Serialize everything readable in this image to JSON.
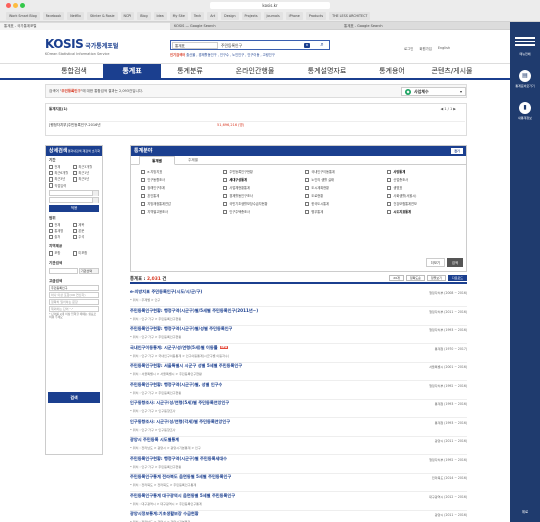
{
  "browser": {
    "url": "kosis.kr",
    "bookmarks": [
      "Work Smart Blog",
      "Facebook",
      "Netflix",
      "Stinter & Rosie",
      "NCPI",
      "Blog",
      "Idea",
      "My Site",
      "Tech",
      "Art",
      "Design",
      "Projects",
      "Journals",
      "iPhone",
      "Products",
      "THE LESS ARCHITECT"
    ],
    "tabs": [
      "통계표 - 국가통계포털",
      "KOSIS — Google Search",
      "통계표 - Google Search"
    ]
  },
  "header": {
    "logo_main": "KOSIS",
    "logo_kr": "국가통계포털",
    "logo_en": "KOrean Statistical Information Service",
    "search_select": "통계표",
    "search_query": "주민등록인구",
    "search_clear": "×",
    "search_button": "⌕",
    "keywords_label": "인기검색어",
    "keywords": "출산율 , 경제활동인구 , 인구수 , 노인인구 , 인구이동 , 고령인구",
    "util_links": [
      "로그인",
      "회원가입",
      "English"
    ]
  },
  "gnb": {
    "items": [
      "통합검색",
      "통계표",
      "통계분류",
      "온라인간행물",
      "통계설명자료",
      "통계용어",
      "콘텐츠/게시물"
    ],
    "active_index": 1
  },
  "result_bar": {
    "text_prefix": "검색어 \"",
    "keyword": "주민등록인구",
    "text_suffix": "\"에 대한 통합검색 결과는 2,093건입니다.",
    "button_label": "사업체수",
    "button_icon": "◆",
    "button_arrow": "▾"
  },
  "number_box": {
    "title": "통계지표(1)",
    "pager": "◀ 1 / 1 ▶",
    "row_label": "[행정자치부]주민등록인구-2016년",
    "row_value": "51,696,216 (명)"
  },
  "side": {
    "title": "상세검색",
    "reset": "결과내검색  재검색  초기화",
    "period_title": "기간",
    "period_options": [
      "전체",
      "최근3개월",
      "최근6개월",
      "최근1년",
      "최근3년",
      "최근5년",
      "직접입력"
    ],
    "from_placeholder": "",
    "to_placeholder": "",
    "apply": "적용",
    "scope_title": "범위",
    "scope_options": [
      "전체",
      "제목",
      "통계명",
      "본문",
      "출처",
      "주석"
    ],
    "sort_title": "지역제공",
    "sort_options": [
      "포함",
      "미포함"
    ],
    "org_title": "기관검색",
    "org_input": "",
    "org_button": "기관선택",
    "advanced_title": "고급검색",
    "adv1": "주민등록인구",
    "adv2": "하나 이상 포함(OR 연산자)",
    "adv3": "정확히 일치하는 문장",
    "adv4": "제외하는 단어 \"-\"",
    "note": "* 단어를 2개 이상 입력할 때에는 쉼표로 띄워 주세요",
    "search_button": "검색"
  },
  "classify": {
    "title": "통계분야",
    "toggle": "접기",
    "tabs": [
      "통계별",
      "주제별"
    ],
    "items": [
      {
        "label": "e-지방지표",
        "bold": false
      },
      {
        "label": "주민등록인구현황",
        "bold": false
      },
      {
        "label": "국내인구이동통계",
        "bold": false
      },
      {
        "label": "사망통계",
        "bold": true
      },
      {
        "label": "인구동향조사",
        "bold": false
      },
      {
        "label": "세대구성통계",
        "bold": true
      },
      {
        "label": "노인의 생활 실태",
        "bold": false
      },
      {
        "label": "산업총조사",
        "bold": false
      },
      {
        "label": "장래인구추계",
        "bold": false
      },
      {
        "label": "사업체현황통계",
        "bold": false
      },
      {
        "label": "도시계획현황",
        "bold": false
      },
      {
        "label": "생명표",
        "bold": false
      },
      {
        "label": "혼인통계",
        "bold": false
      },
      {
        "label": "경제활동인구조사",
        "bold": false
      },
      {
        "label": "도로현황",
        "bold": false
      },
      {
        "label": "사회생활(서울시)",
        "bold": false
      },
      {
        "label": "지방재정통계연감",
        "bold": false
      },
      {
        "label": "국민기초생활보장수급자현황",
        "bold": false
      },
      {
        "label": "한국도시통계",
        "bold": false
      },
      {
        "label": "건강보험통계연보",
        "bold": false
      },
      {
        "label": "지역별고용조사",
        "bold": false
      },
      {
        "label": "인구주택총조사",
        "bold": false
      },
      {
        "label": "병무통계",
        "bold": false
      },
      {
        "label": "시도지표통계",
        "bold": true
      }
    ],
    "btn_more": "더보기",
    "btn_search": "검색"
  },
  "results": {
    "count_label": "통계표",
    "count": "2,031",
    "count_unit": "건",
    "controls": [
      "20개",
      "정확도순",
      "정렬보기",
      "다운로드"
    ],
    "items": [
      {
        "title": "e-지방지표 주민등록인구(시도/시/군/구)",
        "path": "• 위치 : 주제별 > 인구",
        "org": "행정자치부 (2008 ~ 2016)"
      },
      {
        "title": "주민등록인구현황: 행정구역(시군구)별/5세별 주민등록인구(2011년~)",
        "path": "• 위치 : 인구·가구 > 주민등록인구현황",
        "org": "행정자치부 (2011 ~ 2016)"
      },
      {
        "title": "주민등록인구현황: 행정구역(시군구)별/성별 주민등록인구",
        "path": "• 위치 : 인구·가구 > 주민등록인구현황",
        "org": "행정자치부 (1993 ~ 2016)"
      },
      {
        "title": "국내인구이동통계: 시군구/성/연령(5세)별 이동률",
        "path": "• 위치 : 인구·가구 > 국내인구이동통계 > 인구이동통계(시군구별 이동자수)",
        "org": "통계청 (1970 ~ 2017)"
      },
      {
        "title": "주민등록인구현황: 서울특별시 시군구 성별 5세별 주민등록인구",
        "path": "• 위치 : 서울특별시 > 서울특별시 > 주민등록인구현황",
        "org": "서울특별시 (2001 ~ 2016)"
      },
      {
        "title": "주민등록인구현황: 행정구역(시군구)별, 성별 인구수",
        "path": "• 위치 : 인구·가구 > 주민등록인구현황",
        "org": "행정자치부 (1992 ~ 2016)"
      },
      {
        "title": "인구동향조사: 시군구/성/연령(5세)별 주민등록연앙인구",
        "path": "• 위치 : 인구·가구 > 인구동향조사",
        "org": "통계청 (1993 ~ 2016)"
      },
      {
        "title": "인구동향조사: 시군구/성/연령(각세)별 주민등록연앙인구",
        "path": "• 위치 : 인구·가구 > 인구동향조사",
        "org": "통계청 (1993 ~ 2016)"
      },
      {
        "title": "광양시 주민등록 시도별통계",
        "path": "• 위치 : 전라남도 > 광양시 > 광양시기본통계 > 인구",
        "org": "광양시 (2011 ~ 2016)"
      },
      {
        "title": "주민등록인구현황: 행정구역(시군구)별 주민등록세대수",
        "path": "• 위치 : 인구·가구 > 주민등록인구현황",
        "org": "행정자치부 (1992 ~ 2016)"
      },
      {
        "title": "주민등록인구통계 전라북도 읍면동별 5세별 주민등록인구",
        "path": "• 위치 : 전라북도 > 전라북도 > 주민등록인구통계",
        "org": "전라북도 (2014 ~ 2016)"
      },
      {
        "title": "주민등록인구통계 대구광역시 읍면동별 5세별 주민등록인구",
        "path": "• 위치 : 대구광역시 > 대구광역시 > 주민등록인구통계",
        "org": "대구광역시 (2012 ~ 2016)"
      },
      {
        "title": "광양시정보통계:기초생활보장 수급현황",
        "path": "• 위치 : 전라남도 > 광양시 > 광양시기본통계",
        "org": "광양시 (2011 ~ 2016)"
      }
    ],
    "new_tag": "NEW"
  },
  "right_panel": {
    "menu_label": "메뉴전체",
    "items": [
      "통계표바로가기",
      "내통계정보"
    ],
    "bottom": "위로"
  },
  "colors": {
    "brand": "#1b3f8f",
    "accent": "#d7351f",
    "panel": "#1f3b6e"
  }
}
